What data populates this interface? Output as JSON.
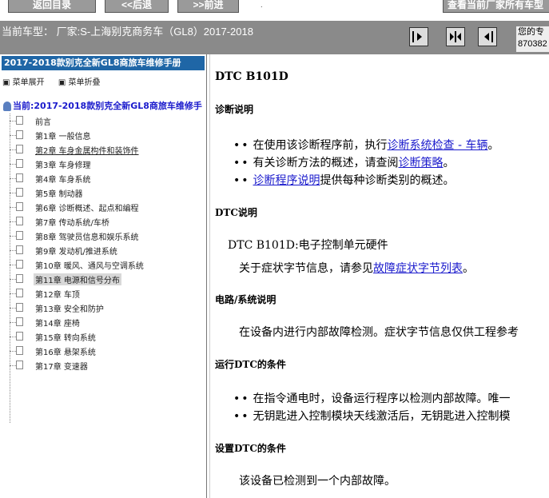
{
  "toolbar": {
    "home_label": "返回目录",
    "back_label": "<<后退",
    "forward_label": ">>前进",
    "view_label": "查看当前厂家所有车型",
    "dot": "."
  },
  "model_bar": {
    "label": "当前车型： 厂家:S-上海别克商务车（GL8）2017-2018",
    "helper_line1": "您的专",
    "helper_line2": "870382"
  },
  "nav_icons": [
    "first-page-icon",
    "split-page-icon",
    "last-page-icon"
  ],
  "left": {
    "manual_title": "2017-2018款别克全新GL8商旅车维修手册",
    "expand_label": "菜单展开",
    "collapse_label": "菜单折叠",
    "root_label": "当前:2017-2018款别克全新GL8商旅车维修手",
    "items": [
      {
        "label": "前言"
      },
      {
        "label": "第1章 一般信息"
      },
      {
        "label": "第2章 车身金属构件和装饰件"
      },
      {
        "label": "第3章 车身修理"
      },
      {
        "label": "第4章 车身系统"
      },
      {
        "label": "第5章 制动器"
      },
      {
        "label": "第6章 诊断概述、起点和编程"
      },
      {
        "label": "第7章 传动系统/车桥"
      },
      {
        "label": "第8章 驾驶员信息和娱乐系统"
      },
      {
        "label": "第9章 发动机/推进系统"
      },
      {
        "label": "第10章 暖风、通风与空调系统"
      },
      {
        "label": "第11章 电源和信号分布"
      },
      {
        "label": "第12章 车顶"
      },
      {
        "label": "第13章 安全和防护"
      },
      {
        "label": "第14章 座椅"
      },
      {
        "label": "第15章 转向系统"
      },
      {
        "label": "第16章 悬架系统"
      },
      {
        "label": "第17章 变速器"
      }
    ]
  },
  "content": {
    "title": "DTC B101D",
    "diag_heading": "诊断说明",
    "diag_b1_pre": "在使用该诊断程序前，执行",
    "diag_b1_link": "诊断系统检查 - 车辆",
    "diag_b1_post": "。",
    "diag_b2_pre": "有关诊断方法的概述，请查阅",
    "diag_b2_link": "诊断策略",
    "diag_b2_post": "。",
    "diag_b3_link": "诊断程序说明",
    "diag_b3_post": "提供每种诊断类别的概述。",
    "dtc_heading": "DTC说明",
    "dtc_line": "DTC B101D:电子控制单元硬件",
    "dtc_sub_pre": "关于症状字节信息，请参见",
    "dtc_sub_link": "故障症状字节列表",
    "dtc_sub_post": "。",
    "circuit_heading": "电路/系统说明",
    "circuit_text": "在设备内进行内部故障检测。症状字节信息仅供工程参考",
    "run_heading": "运行DTC的条件",
    "run_b1": "在指令通电时，设备运行程序以检测内部故障。唯一",
    "run_b2": "无钥匙进入控制模块天线激活后，无钥匙进入控制模",
    "set_heading": "设置DTC的条件",
    "set_text": "该设备已检测到一个内部故障。"
  }
}
